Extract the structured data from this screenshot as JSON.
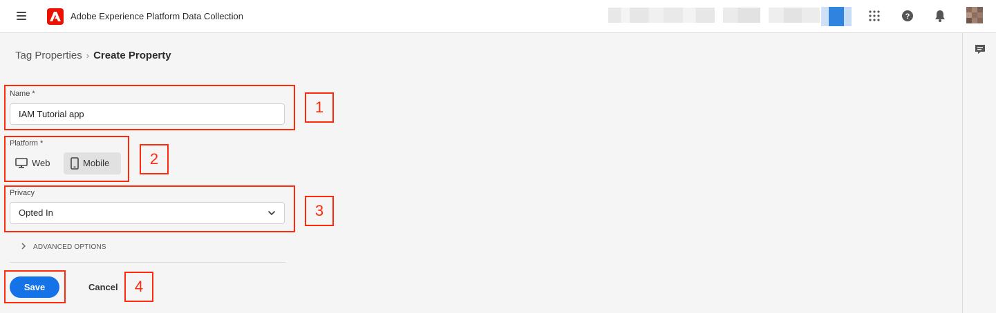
{
  "header": {
    "app_title": "Adobe Experience Platform Data Collection",
    "icons": [
      "menu-icon",
      "adobe-logo",
      "apps-grid-icon",
      "help-icon",
      "notifications-bell-icon",
      "avatar"
    ]
  },
  "breadcrumb": {
    "parent": "Tag Properties",
    "separator": "›",
    "current": "Create Property"
  },
  "form": {
    "name_label": "Name *",
    "name_value": "IAM Tutorial app",
    "platform_label": "Platform *",
    "platform_options": [
      "Web",
      "Mobile"
    ],
    "platform_selected": "Mobile",
    "privacy_label": "Privacy",
    "privacy_value": "Opted In",
    "advanced_label": "ADVANCED OPTIONS",
    "save_label": "Save",
    "cancel_label": "Cancel"
  },
  "callouts": [
    "1",
    "2",
    "3",
    "4"
  ],
  "colors": {
    "accent": "#1473e6",
    "brand": "#eb1000",
    "callout": "#ff2a0c",
    "background": "#f5f5f5"
  }
}
